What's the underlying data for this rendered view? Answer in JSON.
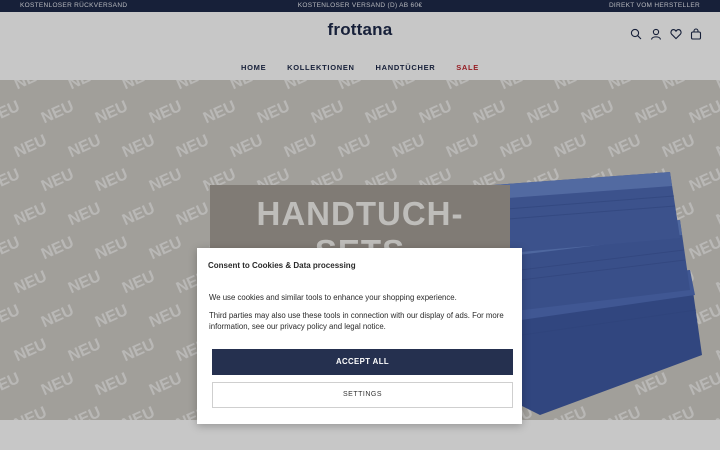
{
  "topbar": {
    "left": "KOSTENLOSER RÜCKVERSAND",
    "center": "KOSTENLOSER VERSAND (D) AB 60€",
    "right": "DIREKT VOM HERSTELLER"
  },
  "header": {
    "logo": "frottana",
    "icons": [
      "search-icon",
      "account-icon",
      "wishlist-heart-icon",
      "cart-bag-icon"
    ]
  },
  "nav": {
    "items": [
      {
        "label": "HOME"
      },
      {
        "label": "KOLLEKTIONEN"
      },
      {
        "label": "HANDTÜCHER"
      },
      {
        "label": "SALE"
      }
    ]
  },
  "hero": {
    "watermark": "NEU",
    "title": "HANDTUCH-SETS",
    "colors": {
      "background": "#cfccc6",
      "towel": "#4a66b0",
      "title_box": "#a59e96"
    }
  },
  "consent": {
    "title": "Consent to Cookies & Data processing",
    "paragraph1": "We use cookies and similar tools to enhance your shopping experience.",
    "paragraph2": "Third parties may also use these tools in connection with our display of ads. For more information, see our privacy policy and legal notice.",
    "accept_label": "ACCEPT ALL",
    "settings_label": "SETTINGS"
  },
  "colors": {
    "brand_navy": "#1e2a4a",
    "sale_red": "#c0262e"
  }
}
